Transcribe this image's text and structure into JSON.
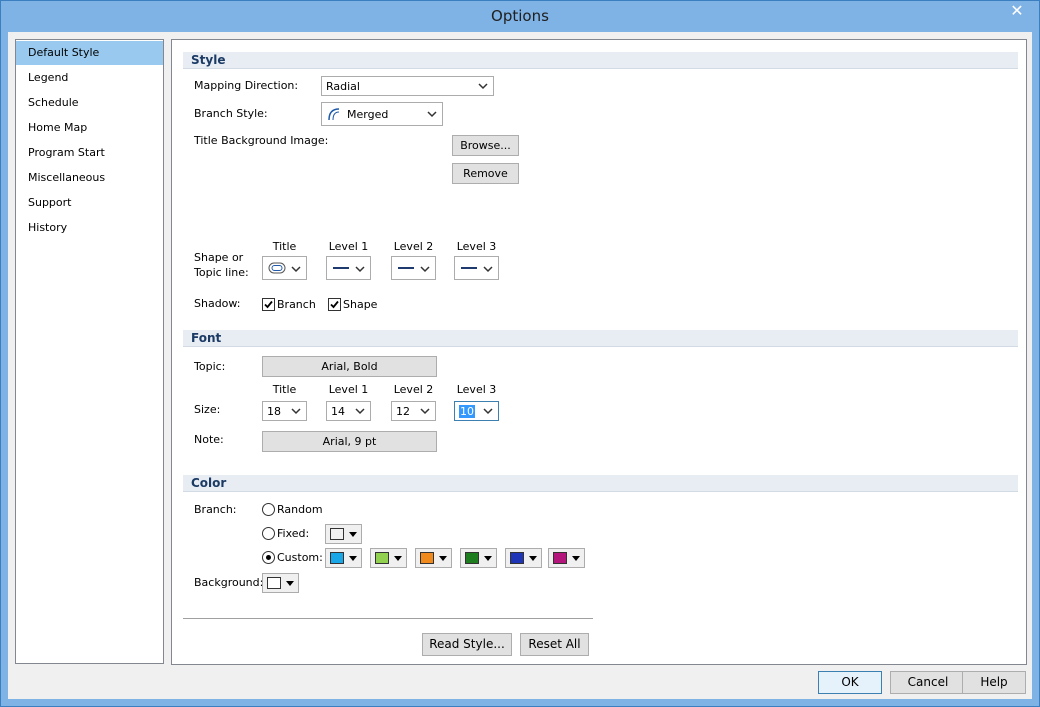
{
  "window": {
    "title": "Options",
    "close_glyph": "✕"
  },
  "nav": {
    "items": [
      {
        "label": "Default Style",
        "selected": true
      },
      {
        "label": "Legend"
      },
      {
        "label": "Schedule"
      },
      {
        "label": "Home Map"
      },
      {
        "label": "Program Start"
      },
      {
        "label": "Miscellaneous"
      },
      {
        "label": "Support"
      },
      {
        "label": "History"
      }
    ]
  },
  "style": {
    "header": "Style",
    "mapping_direction_label": "Mapping Direction:",
    "mapping_direction_value": "Radial",
    "branch_style_label": "Branch Style:",
    "branch_style_value": "Merged",
    "title_bg_label": "Title Background Image:",
    "browse_label": "Browse...",
    "remove_label": "Remove",
    "shape_label_1": "Shape or",
    "shape_label_2": "Topic line:",
    "columns": [
      "Title",
      "Level 1",
      "Level 2",
      "Level 3"
    ],
    "shadow_label": "Shadow:",
    "shadow_branch_label": "Branch",
    "shadow_shape_label": "Shape",
    "shadow_branch_checked": true,
    "shadow_shape_checked": true
  },
  "font": {
    "header": "Font",
    "topic_label": "Topic:",
    "topic_value": "Arial, Bold",
    "size_label": "Size:",
    "columns": [
      "Title",
      "Level 1",
      "Level 2",
      "Level 3"
    ],
    "sizes": [
      "18",
      "14",
      "12",
      "10"
    ],
    "note_label": "Note:",
    "note_value": "Arial, 9 pt"
  },
  "color": {
    "header": "Color",
    "branch_label": "Branch:",
    "random_label": "Random",
    "fixed_label": "Fixed:",
    "custom_label": "Custom:",
    "selected_mode": "Custom",
    "fixed_color": "#f2f2f2",
    "custom_colors": [
      "#1aa7e8",
      "#92d050",
      "#f08a1c",
      "#1e7d1e",
      "#1f35b8",
      "#b3157a"
    ],
    "background_label": "Background:",
    "background_color": "#ffffff"
  },
  "actions": {
    "read_style_label": "Read Style...",
    "reset_all_label": "Reset All"
  },
  "dialog": {
    "ok_label": "OK",
    "cancel_label": "Cancel",
    "help_label": "Help"
  }
}
